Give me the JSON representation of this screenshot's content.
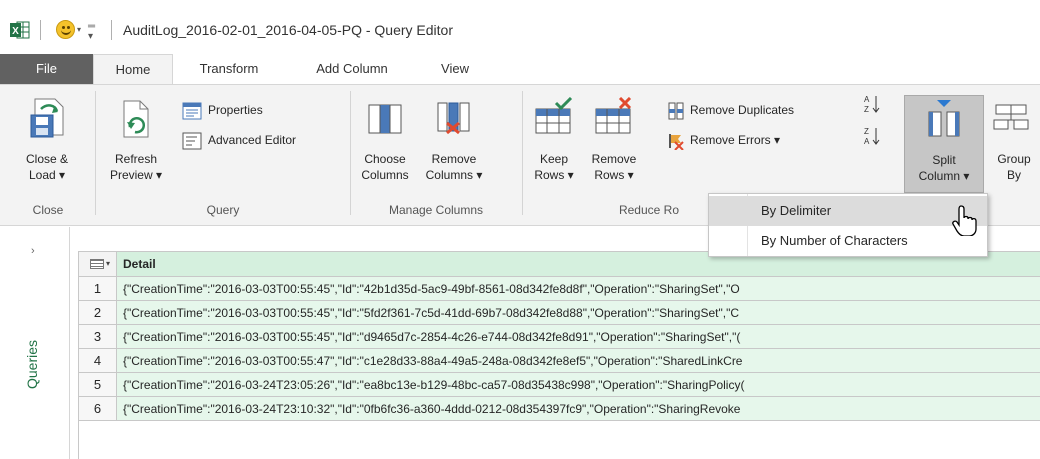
{
  "window": {
    "title": "AuditLog_2016-02-01_2016-04-05-PQ - Query Editor"
  },
  "tabs": [
    {
      "label": "File"
    },
    {
      "label": "Home"
    },
    {
      "label": "Transform"
    },
    {
      "label": "Add Column"
    },
    {
      "label": "View"
    }
  ],
  "ribbon": {
    "close": {
      "close_load": {
        "line1": "Close &",
        "line2": "Load ▾"
      },
      "group_label": "Close"
    },
    "query": {
      "refresh": {
        "line1": "Refresh",
        "line2": "Preview ▾"
      },
      "properties": "Properties",
      "advanced_editor": "Advanced Editor",
      "group_label": "Query"
    },
    "manage_columns": {
      "choose": {
        "line1": "Choose",
        "line2": "Columns"
      },
      "remove": {
        "line1": "Remove",
        "line2": "Columns ▾"
      },
      "group_label": "Manage Columns"
    },
    "reduce_rows": {
      "keep": {
        "line1": "Keep",
        "line2": "Rows ▾"
      },
      "remove": {
        "line1": "Remove",
        "line2": "Rows ▾"
      },
      "remove_duplicates": "Remove Duplicates",
      "remove_errors": "Remove Errors ▾",
      "group_label": "Reduce Ro"
    },
    "split_column": {
      "line1": "Split",
      "line2": "Column ▾"
    },
    "group_by": {
      "line1": "Group",
      "line2": "By"
    }
  },
  "split_menu": {
    "items": [
      "By Delimiter",
      "By Number of Characters"
    ]
  },
  "queries_pane": {
    "label": "Queries",
    "chevron": "›"
  },
  "grid": {
    "column_header": "Detail",
    "rows": [
      {
        "num": "1",
        "value": "{\"CreationTime\":\"2016-03-03T00:55:45\",\"Id\":\"42b1d35d-5ac9-49bf-8561-08d342fe8d8f\",\"Operation\":\"SharingSet\",\"O"
      },
      {
        "num": "2",
        "value": "{\"CreationTime\":\"2016-03-03T00:55:45\",\"Id\":\"5fd2f361-7c5d-41dd-69b7-08d342fe8d88\",\"Operation\":\"SharingSet\",\"C"
      },
      {
        "num": "3",
        "value": "{\"CreationTime\":\"2016-03-03T00:55:45\",\"Id\":\"d9465d7c-2854-4c26-e744-08d342fe8d91\",\"Operation\":\"SharingSet\",\"("
      },
      {
        "num": "4",
        "value": "{\"CreationTime\":\"2016-03-03T00:55:47\",\"Id\":\"c1e28d33-88a4-49a5-248a-08d342fe8ef5\",\"Operation\":\"SharedLinkCre"
      },
      {
        "num": "5",
        "value": "{\"CreationTime\":\"2016-03-24T23:05:26\",\"Id\":\"ea8bc13e-b129-48bc-ca57-08d35438c998\",\"Operation\":\"SharingPolicy("
      },
      {
        "num": "6",
        "value": "{\"CreationTime\":\"2016-03-24T23:10:32\",\"Id\":\"0fb6fc36-a360-4ddd-0212-08d354397fc9\",\"Operation\":\"SharingRevoke"
      }
    ]
  },
  "colors": {
    "excel_green": "#217346",
    "file_tab": "#616161",
    "ribbon_bg": "#f3f3f3",
    "column_header_bg": "#d5f0de",
    "cell_bg": "#e6f7eb",
    "accent_blue": "#2b79d0"
  }
}
